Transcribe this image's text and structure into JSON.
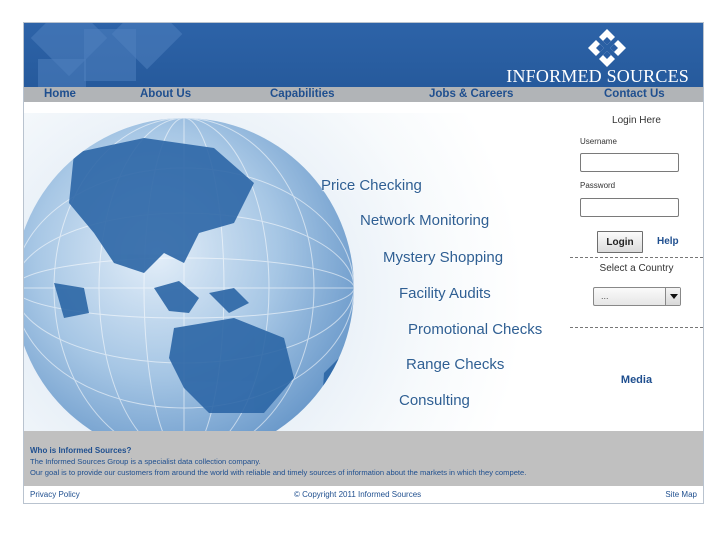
{
  "header": {
    "logo_text": "INFORMED SOURCES",
    "colors": {
      "header_bg": "#2a5ea3",
      "nav_bg": "#b1b4b7",
      "link": "#1f4f8f"
    }
  },
  "nav": {
    "items": [
      {
        "label": "Home"
      },
      {
        "label": "About Us"
      },
      {
        "label": "Capabilities"
      },
      {
        "label": "Jobs & Careers"
      },
      {
        "label": "Contact Us"
      }
    ]
  },
  "hero": {
    "services": [
      "Price Checking",
      "Network Monitoring",
      "Mystery Shopping",
      "Facility Audits",
      "Promotional Checks",
      "Range Checks",
      "Consulting"
    ]
  },
  "login": {
    "title": "Login Here",
    "username_label": "Username",
    "username_value": "",
    "password_label": "Password",
    "password_value": "",
    "button_label": "Login",
    "help_label": "Help",
    "country_label": "Select a Country",
    "country_selected": "...",
    "media_label": "Media"
  },
  "about": {
    "title": "Who is Informed Sources?",
    "line1": "The Informed Sources Group is a specialist data collection company.",
    "line2": "Our goal is to provide our customers from around the world with reliable and timely sources of information about the markets in which they compete."
  },
  "footer": {
    "privacy": "Privacy Policy",
    "copyright": "© Copyright 2011 Informed Sources",
    "sitemap": "Site Map"
  }
}
